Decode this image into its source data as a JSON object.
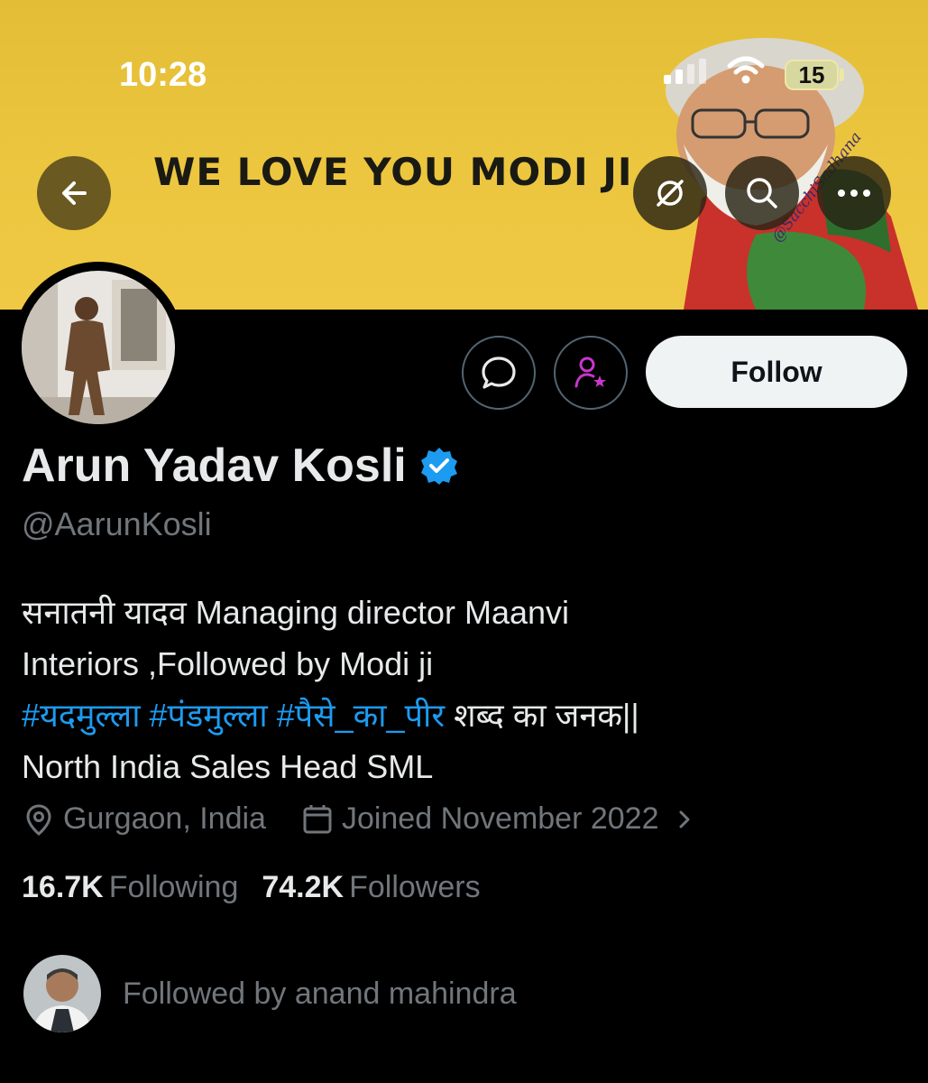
{
  "status_bar": {
    "time": "10:28",
    "battery": "15"
  },
  "banner": {
    "text": "WE LOVE YOU MODI JI",
    "watermark": "@SacchiSadhana",
    "color": "#ecc63f"
  },
  "header_buttons": {
    "back": "back-arrow-icon",
    "grok": "grok-icon",
    "search": "search-icon",
    "more": "more-icon"
  },
  "profile": {
    "name": "Arun Yadav Kosli",
    "verified": true,
    "handle": "@AarunKosli",
    "bio": {
      "line1": "सनातनी यादव Managing director Maanvi",
      "line2": "Interiors ,Followed by Modi ji",
      "hashtags": [
        "#यदमुल्ला",
        "#पंडमुल्ला",
        "#पैसे_का_पीर"
      ],
      "line3_tail": "शब्द का जनक||",
      "line4": "North India Sales Head SML"
    },
    "location": "Gurgaon, India",
    "joined": "Joined November 2022",
    "following_count": "16.7K",
    "following_label": "Following",
    "followers_count": "74.2K",
    "followers_label": "Followers",
    "followed_by": "Followed by anand mahindra"
  },
  "actions": {
    "follow_label": "Follow"
  },
  "colors": {
    "link": "#1d9bf0",
    "verified": "#1d9bf0",
    "subscribe": "#c936cc",
    "muted": "#71767b"
  }
}
